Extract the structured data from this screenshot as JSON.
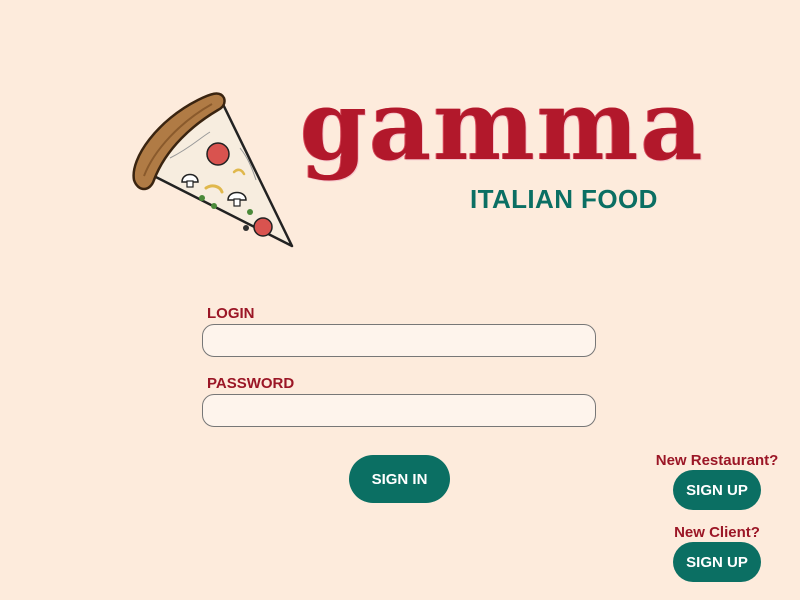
{
  "brand": {
    "name": "gamma",
    "tagline": "ITALIAN FOOD",
    "logo_icon": "pizza-slice-icon"
  },
  "login_form": {
    "login_label": "LOGIN",
    "login_value": "",
    "password_label": "PASSWORD",
    "password_value": "",
    "submit_label": "SIGN IN"
  },
  "signup": {
    "restaurant": {
      "prompt": "New Restaurant?",
      "button_label": "SIGN UP"
    },
    "client": {
      "prompt": "New Client?",
      "button_label": "SIGN UP"
    }
  },
  "colors": {
    "background": "#fdebdc",
    "brand_red": "#b2182b",
    "accent_teal": "#0b6f63",
    "label_red": "#9b1626"
  }
}
